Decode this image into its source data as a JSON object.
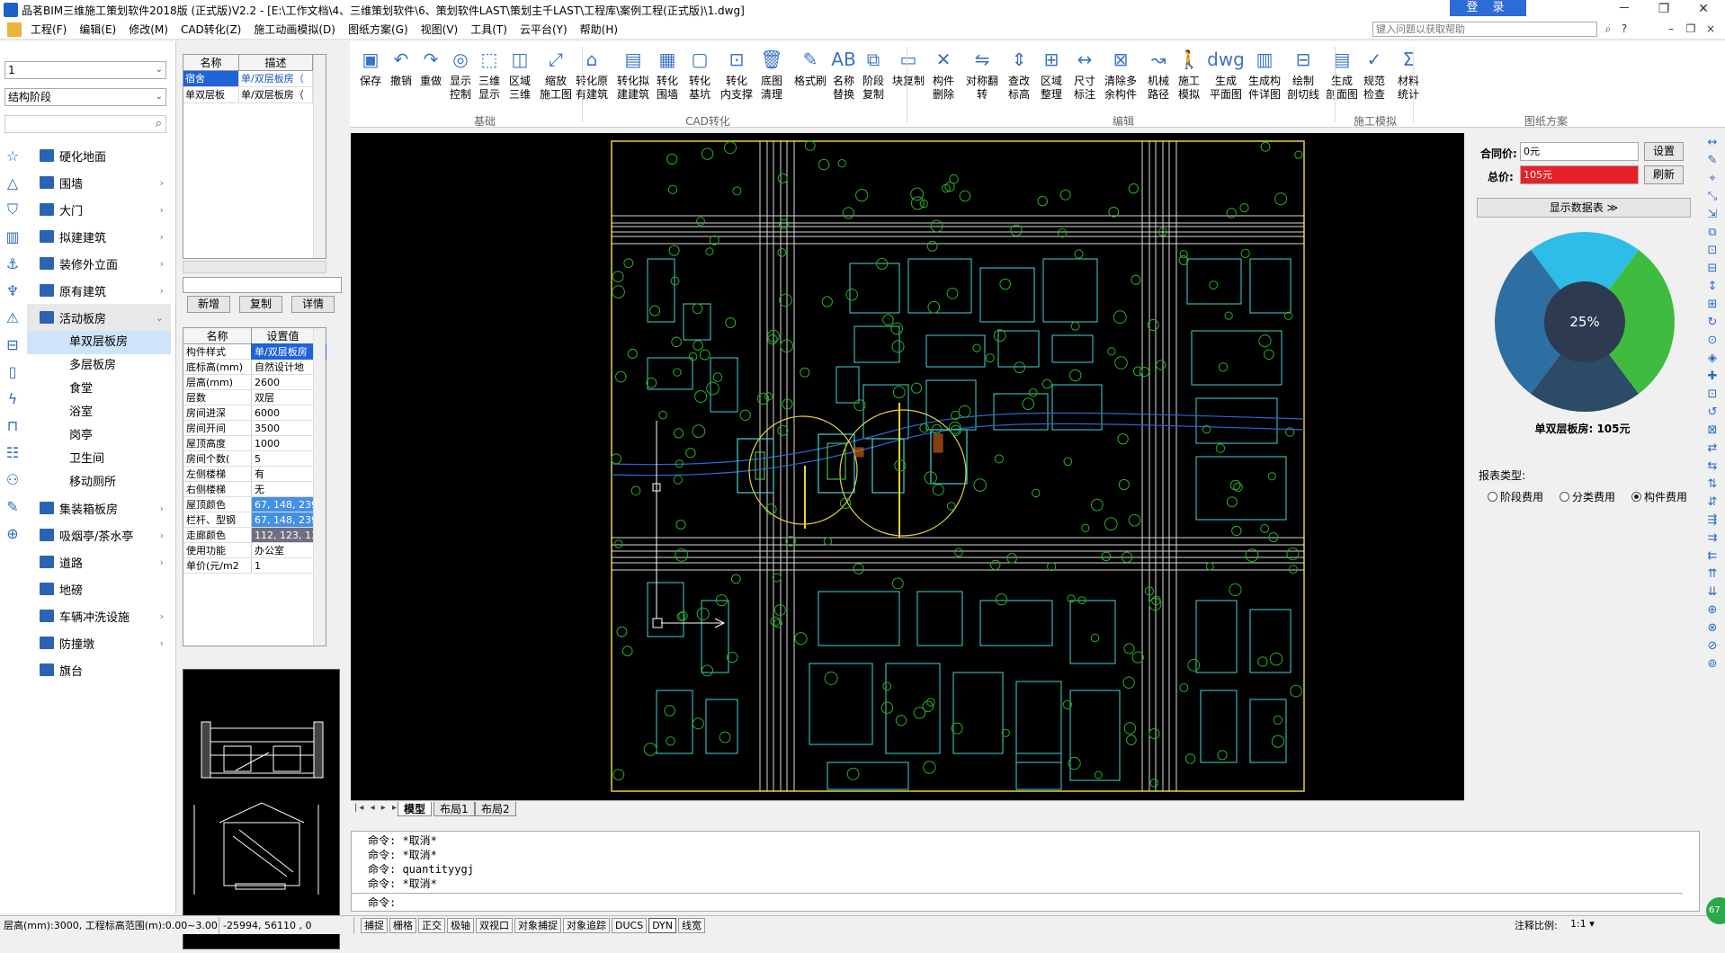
{
  "window": {
    "title": "品茗BIM三维施工策划软件2018版 (正式版)V2.2 - [E:\\工作文档\\4、三维策划软件\\6、策划软件LAST\\策划主千LAST\\工程库\\案例工程(正式版)\\1.dwg]",
    "login_label": "登 录",
    "minimize": "－",
    "restore": "❐",
    "close": "✕"
  },
  "menu": [
    "工程(F)",
    "编辑(E)",
    "修改(M)",
    "CAD转化(Z)",
    "施工动画模拟(D)",
    "图纸方案(G)",
    "视图(V)",
    "工具(T)",
    "云平台(Y)",
    "帮助(H)"
  ],
  "help_search": {
    "placeholder": "键入问题以获取帮助"
  },
  "left": {
    "floor_combo": "1",
    "stage_combo": "结构阶段",
    "tree": [
      {
        "label": "硬化地面",
        "chev": ""
      },
      {
        "label": "围墙",
        "chev": "›"
      },
      {
        "label": "大门",
        "chev": "›"
      },
      {
        "label": "拟建建筑",
        "chev": "›"
      },
      {
        "label": "装修外立面",
        "chev": "›"
      },
      {
        "label": "原有建筑",
        "chev": "›"
      },
      {
        "label": "活动板房",
        "chev": "⌄"
      }
    ],
    "sub_items": [
      "单双层板房",
      "多层板房",
      "食堂",
      "浴室",
      "岗亭",
      "卫生间",
      "移动厕所"
    ],
    "tree2": [
      {
        "label": "集装箱板房",
        "chev": "›"
      },
      {
        "label": "吸烟亭/茶水亭",
        "chev": "›"
      },
      {
        "label": "道路",
        "chev": "›"
      },
      {
        "label": "地磅",
        "chev": ""
      },
      {
        "label": "车辆冲洗设施",
        "chev": "›"
      },
      {
        "label": "防撞墩",
        "chev": "›"
      },
      {
        "label": "旗台",
        "chev": ""
      }
    ]
  },
  "component_list": {
    "headers": [
      "名称",
      "描述"
    ],
    "rows": [
      {
        "name": "宿舍",
        "desc": "单/双层板房（"
      },
      {
        "name": "单双层板",
        "desc": "单/双层板房（"
      }
    ],
    "buttons": [
      "新增",
      "复制",
      "详情"
    ]
  },
  "properties": {
    "headers": [
      "名称",
      "设置值"
    ],
    "rows": [
      {
        "k": "构件样式",
        "v": "单/双层板房"
      },
      {
        "k": "底标高(mm)",
        "v": "自然设计地"
      },
      {
        "k": "层高(mm)",
        "v": "2600"
      },
      {
        "k": "层数",
        "v": "双层"
      },
      {
        "k": "房间进深",
        "v": "6000"
      },
      {
        "k": "房间开间",
        "v": "3500"
      },
      {
        "k": "屋顶高度",
        "v": "1000"
      },
      {
        "k": "房间个数(",
        "v": "5"
      },
      {
        "k": "左侧楼梯",
        "v": "有"
      },
      {
        "k": "右侧楼梯",
        "v": "无"
      },
      {
        "k": "屋顶颜色",
        "v": "67, 148, 239"
      },
      {
        "k": "栏杆、型钢",
        "v": "67, 148, 239"
      },
      {
        "k": "走廊颜色",
        "v": "112, 123, 139"
      },
      {
        "k": "使用功能",
        "v": "办公室"
      },
      {
        "k": "单价(元/m2",
        "v": "1"
      }
    ]
  },
  "ribbon": {
    "buttons": [
      {
        "label": "保存",
        "icon": "save-icon",
        "glyph": "▣"
      },
      {
        "label": "撤销",
        "icon": "undo-icon",
        "glyph": "↶"
      },
      {
        "label": "重做",
        "icon": "redo-icon",
        "glyph": "↷"
      },
      {
        "label": "显示\n控制",
        "icon": "bulb-icon",
        "glyph": "◎"
      },
      {
        "label": "三维\n显示",
        "icon": "3d-icon",
        "glyph": "⬚"
      },
      {
        "label": "区域\n三维",
        "icon": "area-3d-icon",
        "glyph": "◫"
      },
      {
        "label": "缩放\n施工图",
        "icon": "zoom-icon",
        "glyph": "⤢"
      },
      {
        "label": "转化原\n有建筑",
        "icon": "convert-building-icon",
        "glyph": "⌂"
      },
      {
        "label": "转化拟\n建建筑",
        "icon": "convert-plan-icon",
        "glyph": "▤"
      },
      {
        "label": "转化\n围墙",
        "icon": "convert-wall-icon",
        "glyph": "▦"
      },
      {
        "label": "转化\n基坑",
        "icon": "convert-pit-icon",
        "glyph": "▢"
      },
      {
        "label": "转化\n内支撑",
        "icon": "convert-support-icon",
        "glyph": "⊡"
      },
      {
        "label": "底图\n清理",
        "icon": "trash-icon",
        "glyph": "🗑"
      },
      {
        "label": "格式刷",
        "icon": "brush-icon",
        "glyph": "✎"
      },
      {
        "label": "名称\n替换",
        "icon": "rename-icon",
        "glyph": "AB"
      },
      {
        "label": "阶段\n复制",
        "icon": "stage-copy-icon",
        "glyph": "⧉"
      },
      {
        "label": "块复制",
        "icon": "block-copy-icon",
        "glyph": "▭"
      },
      {
        "label": "构件\n删除",
        "icon": "delete-icon",
        "glyph": "✕"
      },
      {
        "label": "对称翻转",
        "icon": "mirror-icon",
        "glyph": "⇋"
      },
      {
        "label": "查改\n标高",
        "icon": "elevation-icon",
        "glyph": "⇕"
      },
      {
        "label": "区域\n整理",
        "icon": "region-icon",
        "glyph": "⊞"
      },
      {
        "label": "尺寸\n标注",
        "icon": "dimension-icon",
        "glyph": "↔"
      },
      {
        "label": "清除多\n余构件",
        "icon": "clean-icon",
        "glyph": "⊠"
      },
      {
        "label": "机械\n路径",
        "icon": "path-icon",
        "glyph": "↝"
      },
      {
        "label": "施工\n模拟",
        "icon": "worker-icon",
        "glyph": "🚶"
      },
      {
        "label": "生成\n平面图",
        "icon": "dwg-icon",
        "glyph": "dwg"
      },
      {
        "label": "生成构\n件详图",
        "icon": "detail-icon",
        "glyph": "▥"
      },
      {
        "label": "绘制\n剖切线",
        "icon": "section-line-icon",
        "glyph": "⊟"
      },
      {
        "label": "生成\n剖面图",
        "icon": "section-icon",
        "glyph": "▤"
      },
      {
        "label": "规范\n检查",
        "icon": "check-icon",
        "glyph": "✓"
      },
      {
        "label": "材料\n统计",
        "icon": "sigma-icon",
        "glyph": "Σ"
      }
    ],
    "groups": [
      "基础",
      "CAD转化",
      "编辑",
      "施工模拟",
      "图纸方案"
    ]
  },
  "layout_tabs": [
    "模型",
    "布局1",
    "布局2"
  ],
  "right": {
    "contract_label": "合同价:",
    "contract_value": "0元",
    "total_label": "总价:",
    "total_value": "105元",
    "set_button": "设置",
    "refresh_button": "刷新",
    "show_data_button": "显示数据表  ≫",
    "pie_center": "25%",
    "pie_label": "单双层板房: 105元",
    "report_type_label": "报表类型:",
    "radios": [
      "阶段费用",
      "分类费用",
      "构件费用"
    ],
    "colors": {
      "cyan": "#2ebde8",
      "green": "#3fbc3f",
      "blue": "#2d6fa3",
      "navy": "#2c4b66",
      "center": "#2e3a4f",
      "total_bg": "#e8202a"
    }
  },
  "commands": [
    "命令: *取消*",
    "命令: *取消*",
    "命令: quantityygj",
    "命令: *取消*"
  ],
  "cmd_prompt": "命令:",
  "status": {
    "info": "层高(mm):3000, 工程标高范围(m):0.00~3.00",
    "coords": "-25994,  56110 , 0",
    "toggles": [
      "捕捉",
      "栅格",
      "正交",
      "极轴",
      "双视口",
      "对象捕捉",
      "对象追踪",
      "DUCS",
      "DYN",
      "线宽"
    ],
    "scale_label": "注释比例:",
    "scale_value": "1:1 ▾"
  },
  "badge": "67"
}
